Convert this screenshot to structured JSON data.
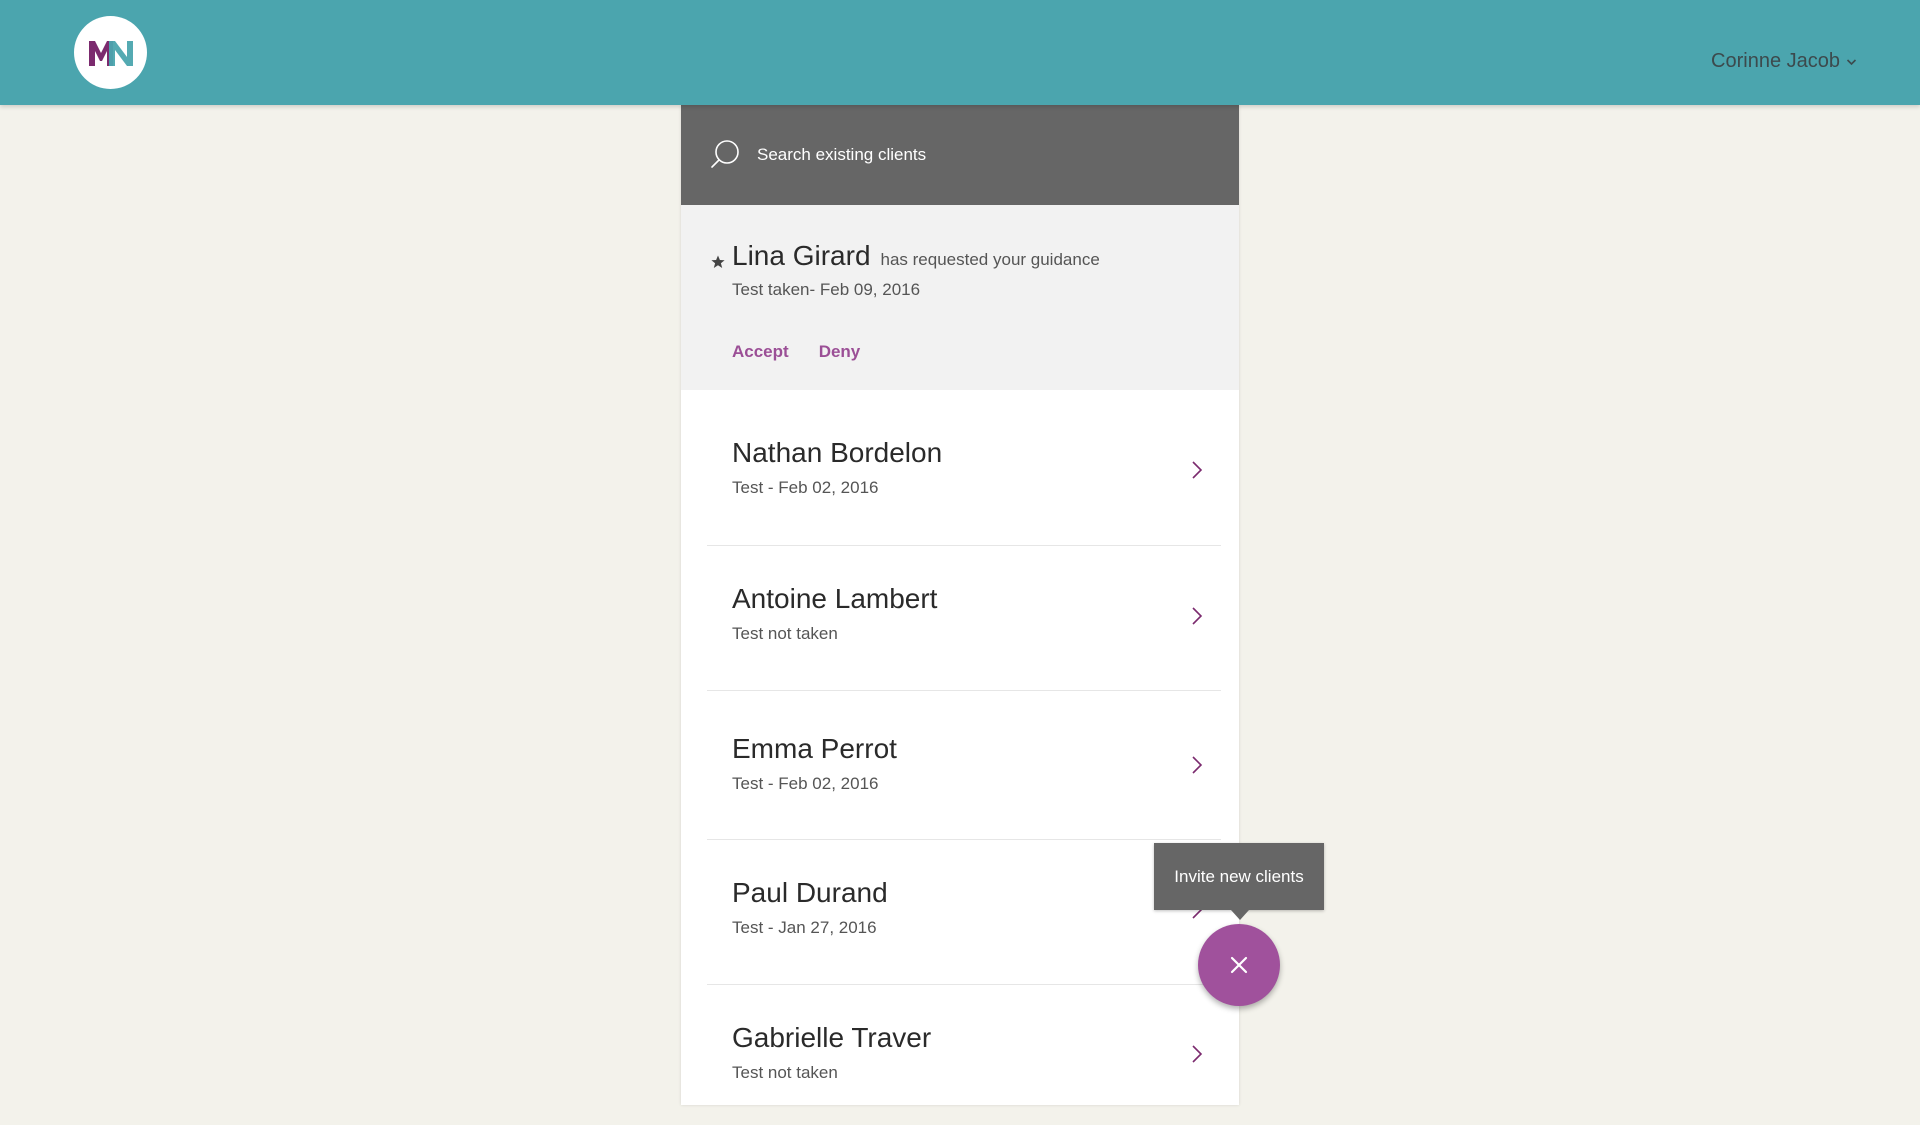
{
  "header": {
    "logo_text": "MN",
    "user_name": "Corinne Jacob",
    "colors": {
      "bar": "#4ba5ae",
      "logo_left": "#7b2a6e",
      "logo_right": "#4ba5ae"
    }
  },
  "search": {
    "placeholder": "Search existing clients",
    "icon": "search-icon"
  },
  "request": {
    "name": "Lina Girard",
    "note": "has requested your guidance",
    "date": "Test taken- Feb 09, 2016",
    "accept_label": "Accept",
    "deny_label": "Deny",
    "icon": "star-icon"
  },
  "clients": [
    {
      "name": "Nathan Bordelon",
      "status": "Test - Feb 02, 2016"
    },
    {
      "name": "Antoine Lambert",
      "status": "Test not taken"
    },
    {
      "name": "Emma Perrot",
      "status": "Test - Feb 02, 2016"
    },
    {
      "name": "Paul Durand",
      "status": "Test - Jan 27, 2016"
    },
    {
      "name": "Gabrielle Traver",
      "status": "Test not taken"
    }
  ],
  "invite": {
    "tooltip": "Invite new clients",
    "fab_icon": "close-icon",
    "color": "#a0519c"
  },
  "accent_color": "#9b4f96"
}
